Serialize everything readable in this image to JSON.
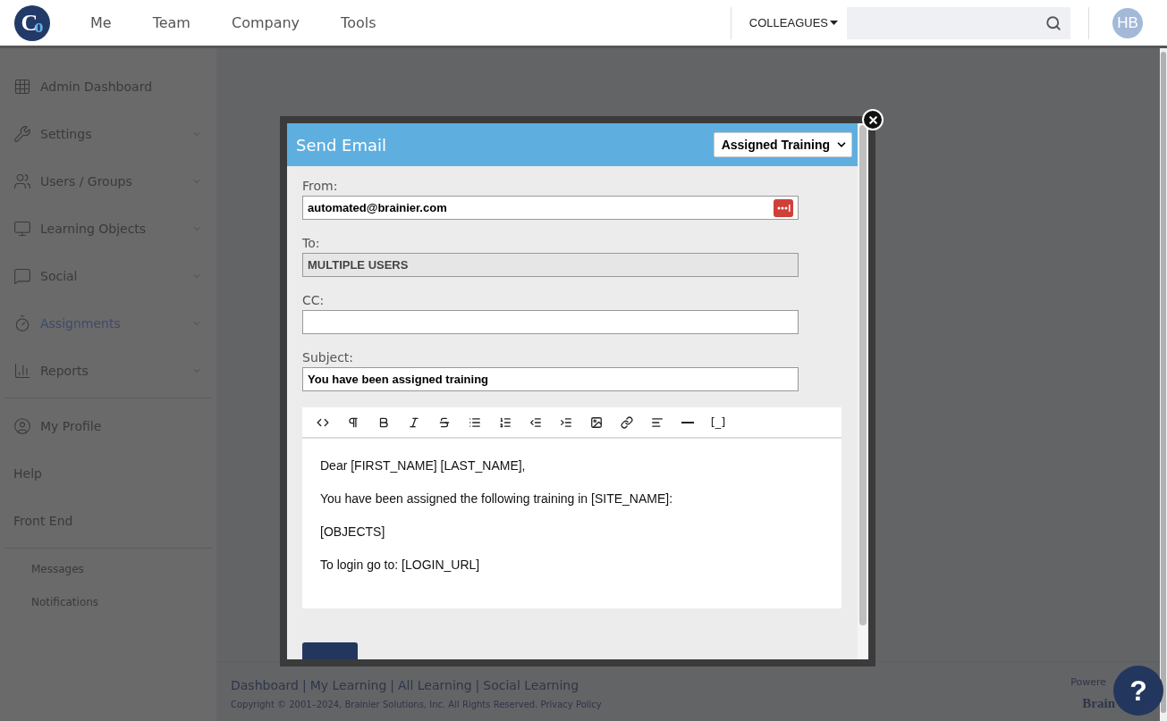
{
  "logo": {
    "letter_1": "C",
    "letter_2": "o"
  },
  "nav": [
    {
      "label": "Me"
    },
    {
      "label": "Team"
    },
    {
      "label": "Company"
    },
    {
      "label": "Tools"
    }
  ],
  "colleagues": {
    "label": "COLLEAGUES"
  },
  "avatar": {
    "initials": "HB"
  },
  "sidebar": {
    "items": [
      {
        "kind": "icon",
        "label": "Admin Dashboard",
        "selected": false,
        "chevron": false
      },
      {
        "kind": "icon",
        "label": "Settings",
        "selected": false,
        "chevron": true
      },
      {
        "kind": "icon",
        "label": "Users / Groups",
        "selected": false,
        "chevron": true
      },
      {
        "kind": "icon",
        "label": "Learning Objects",
        "selected": false,
        "chevron": true
      },
      {
        "kind": "icon",
        "label": "Social",
        "selected": false,
        "chevron": true
      },
      {
        "kind": "icon",
        "label": "Assignments",
        "selected": true,
        "chevron": true
      },
      {
        "kind": "icon",
        "label": "Reports",
        "selected": false,
        "chevron": true
      },
      {
        "kind": "divider"
      },
      {
        "kind": "icon",
        "label": "My Profile",
        "selected": false,
        "chevron": false
      },
      {
        "kind": "plain",
        "label": "Help",
        "selected": false
      },
      {
        "kind": "plain",
        "label": "Front End",
        "selected": false
      },
      {
        "kind": "divider"
      },
      {
        "kind": "sub",
        "label": "Messages",
        "selected": false
      },
      {
        "kind": "sub",
        "label": "Notifications",
        "selected": false
      }
    ]
  },
  "footer": {
    "links": [
      {
        "label": "Dashboard"
      },
      {
        "separator": "|",
        "label": "My Learning"
      },
      {
        "separator": "|",
        "label": "All Learning"
      },
      {
        "separator": "|",
        "label": "Social Learning"
      }
    ],
    "copyright": "Copyright © 2001–2024, Brainier Solutions, Inc. All Rights Reserved.",
    "privacy": "Privacy Policy",
    "powered": "Powere",
    "brand": "Brain"
  },
  "help_button": {
    "label": "?"
  },
  "modal": {
    "title": "Send Email",
    "template": "Assigned Training",
    "fields": [
      {
        "label": "From:",
        "value": "automated@brainier.com",
        "readonly": false,
        "password_icon": true
      },
      {
        "label": "To:",
        "value": "MULTIPLE USERS",
        "readonly": true,
        "password_icon": false
      },
      {
        "label": "CC:",
        "readonly": false,
        "password_icon": false
      },
      {
        "label": "Subject:",
        "value": "You have been assigned training",
        "readonly": false,
        "password_icon": false
      }
    ],
    "toolbar": [
      {
        "kind": "code"
      },
      {
        "kind": "paragraph"
      },
      {
        "kind": "bold"
      },
      {
        "kind": "italic"
      },
      {
        "kind": "strike"
      },
      {
        "kind": "bullets"
      },
      {
        "kind": "numbers"
      },
      {
        "kind": "outdent"
      },
      {
        "kind": "indent"
      },
      {
        "kind": "image"
      },
      {
        "kind": "link"
      },
      {
        "kind": "align"
      },
      {
        "kind": "rule"
      },
      {
        "kind": "text",
        "label": "[_]"
      }
    ],
    "body": [
      "Dear [FIRST_NAME] [LAST_NAME],",
      "You have been assigned the following training in [SITE_NAME]:",
      "[OBJECTS]",
      "To login go to: [LOGIN_URL]"
    ]
  }
}
